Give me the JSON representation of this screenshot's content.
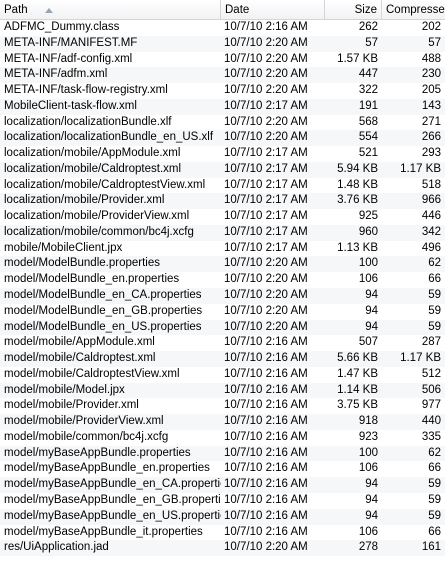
{
  "columns": {
    "path": "Path",
    "date": "Date",
    "size": "Size",
    "compressed": "Compressed",
    "sort_icon": "sort-ascending-icon"
  },
  "rows": [
    {
      "path": "ADFMC_Dummy.class",
      "date": "10/7/10 2:16 AM",
      "size": "262",
      "compressed": "202"
    },
    {
      "path": "META-INF/MANIFEST.MF",
      "date": "10/7/10 2:20 AM",
      "size": "57",
      "compressed": "57"
    },
    {
      "path": "META-INF/adf-config.xml",
      "date": "10/7/10 2:20 AM",
      "size": "1.57 KB",
      "compressed": "488"
    },
    {
      "path": "META-INF/adfm.xml",
      "date": "10/7/10 2:20 AM",
      "size": "447",
      "compressed": "230"
    },
    {
      "path": "META-INF/task-flow-registry.xml",
      "date": "10/7/10 2:20 AM",
      "size": "322",
      "compressed": "205"
    },
    {
      "path": "MobileClient-task-flow.xml",
      "date": "10/7/10 2:17 AM",
      "size": "191",
      "compressed": "143"
    },
    {
      "path": "localization/localizationBundle.xlf",
      "date": "10/7/10 2:20 AM",
      "size": "568",
      "compressed": "271"
    },
    {
      "path": "localization/localizationBundle_en_US.xlf",
      "date": "10/7/10 2:20 AM",
      "size": "554",
      "compressed": "266"
    },
    {
      "path": "localization/mobile/AppModule.xml",
      "date": "10/7/10 2:17 AM",
      "size": "521",
      "compressed": "293"
    },
    {
      "path": "localization/mobile/Caldroptest.xml",
      "date": "10/7/10 2:17 AM",
      "size": "5.94 KB",
      "compressed": "1.17 KB"
    },
    {
      "path": "localization/mobile/CaldroptestView.xml",
      "date": "10/7/10 2:17 AM",
      "size": "1.48 KB",
      "compressed": "518"
    },
    {
      "path": "localization/mobile/Provider.xml",
      "date": "10/7/10 2:17 AM",
      "size": "3.76 KB",
      "compressed": "966"
    },
    {
      "path": "localization/mobile/ProviderView.xml",
      "date": "10/7/10 2:17 AM",
      "size": "925",
      "compressed": "446"
    },
    {
      "path": "localization/mobile/common/bc4j.xcfg",
      "date": "10/7/10 2:17 AM",
      "size": "960",
      "compressed": "342"
    },
    {
      "path": "mobile/MobileClient.jpx",
      "date": "10/7/10 2:17 AM",
      "size": "1.13 KB",
      "compressed": "496"
    },
    {
      "path": "model/ModelBundle.properties",
      "date": "10/7/10 2:20 AM",
      "size": "100",
      "compressed": "62"
    },
    {
      "path": "model/ModelBundle_en.properties",
      "date": "10/7/10 2:20 AM",
      "size": "106",
      "compressed": "66"
    },
    {
      "path": "model/ModelBundle_en_CA.properties",
      "date": "10/7/10 2:20 AM",
      "size": "94",
      "compressed": "59"
    },
    {
      "path": "model/ModelBundle_en_GB.properties",
      "date": "10/7/10 2:20 AM",
      "size": "94",
      "compressed": "59"
    },
    {
      "path": "model/ModelBundle_en_US.properties",
      "date": "10/7/10 2:20 AM",
      "size": "94",
      "compressed": "59"
    },
    {
      "path": "model/mobile/AppModule.xml",
      "date": "10/7/10 2:16 AM",
      "size": "507",
      "compressed": "287"
    },
    {
      "path": "model/mobile/Caldroptest.xml",
      "date": "10/7/10 2:16 AM",
      "size": "5.66 KB",
      "compressed": "1.17 KB"
    },
    {
      "path": "model/mobile/CaldroptestView.xml",
      "date": "10/7/10 2:16 AM",
      "size": "1.47 KB",
      "compressed": "512"
    },
    {
      "path": "model/mobile/Model.jpx",
      "date": "10/7/10 2:16 AM",
      "size": "1.14 KB",
      "compressed": "506"
    },
    {
      "path": "model/mobile/Provider.xml",
      "date": "10/7/10 2:16 AM",
      "size": "3.75 KB",
      "compressed": "977"
    },
    {
      "path": "model/mobile/ProviderView.xml",
      "date": "10/7/10 2:16 AM",
      "size": "918",
      "compressed": "440"
    },
    {
      "path": "model/mobile/common/bc4j.xcfg",
      "date": "10/7/10 2:16 AM",
      "size": "923",
      "compressed": "335"
    },
    {
      "path": "model/myBaseAppBundle.properties",
      "date": "10/7/10 2:16 AM",
      "size": "100",
      "compressed": "62"
    },
    {
      "path": "model/myBaseAppBundle_en.properties",
      "date": "10/7/10 2:16 AM",
      "size": "106",
      "compressed": "66"
    },
    {
      "path": "model/myBaseAppBundle_en_CA.properties",
      "date": "10/7/10 2:16 AM",
      "size": "94",
      "compressed": "59"
    },
    {
      "path": "model/myBaseAppBundle_en_GB.properties",
      "date": "10/7/10 2:16 AM",
      "size": "94",
      "compressed": "59"
    },
    {
      "path": "model/myBaseAppBundle_en_US.properties",
      "date": "10/7/10 2:16 AM",
      "size": "94",
      "compressed": "59"
    },
    {
      "path": "model/myBaseAppBundle_it.properties",
      "date": "10/7/10 2:16 AM",
      "size": "106",
      "compressed": "66"
    },
    {
      "path": "res/UiApplication.jad",
      "date": "10/7/10 2:20 AM",
      "size": "278",
      "compressed": "161"
    }
  ]
}
